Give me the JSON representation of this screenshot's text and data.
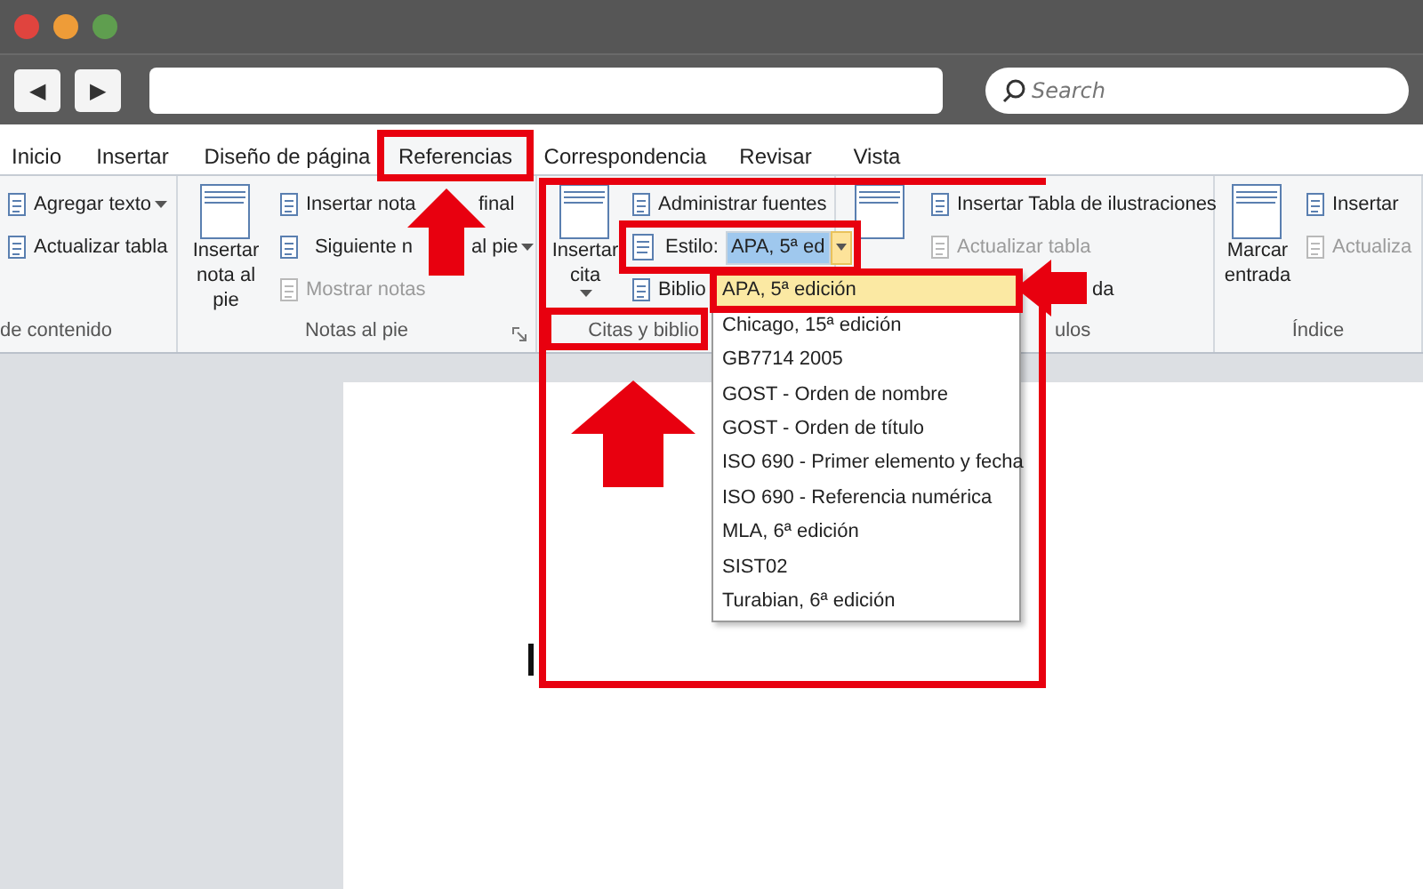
{
  "window": {
    "controls": [
      {
        "color": "#e0443e"
      },
      {
        "color": "#ee9c38"
      },
      {
        "color": "#5f9e4f"
      }
    ]
  },
  "browser": {
    "back": "◀",
    "forward": "▶",
    "search": {
      "placeholder": "Search"
    }
  },
  "tabs": [
    {
      "label": "Inicio",
      "selected": false
    },
    {
      "label": "Insertar",
      "selected": false
    },
    {
      "label": "Diseño de página",
      "selected": false
    },
    {
      "label": "Referencias",
      "selected": true
    },
    {
      "label": "Correspondencia",
      "selected": false
    },
    {
      "label": "Revisar",
      "selected": false
    },
    {
      "label": "Vista",
      "selected": false
    }
  ],
  "ribbon": {
    "groups": [
      {
        "label": "de contenido",
        "launcher": false,
        "items": [
          {
            "kind": "button",
            "parts": [
              "Agregar texto"
            ],
            "caret": true,
            "disabled": false
          },
          {
            "kind": "button",
            "parts": [
              "Actualizar tabla"
            ],
            "caret": false,
            "disabled": false
          }
        ]
      },
      {
        "label": "Notas al pie",
        "launcher": true,
        "big": {
          "label": "Insertar nota al pie",
          "caret": false
        },
        "items": [
          {
            "kind": "button",
            "parts": [
              "Insertar nota",
              "final"
            ],
            "caret": false,
            "disabled": false
          },
          {
            "kind": "button",
            "parts": [
              "Siguiente n",
              "al pie"
            ],
            "caret": true,
            "disabled": false
          },
          {
            "kind": "button",
            "parts": [
              "Mostrar notas"
            ],
            "caret": false,
            "disabled": true
          }
        ]
      },
      {
        "label": "Citas y biblio",
        "launcher": false,
        "big": {
          "label": "Insertar cita",
          "caret": true
        },
        "items": [
          {
            "kind": "button",
            "parts": [
              "Administrar fuentes"
            ],
            "caret": false,
            "disabled": false
          },
          {
            "kind": "style",
            "label": "Estilo:",
            "value": "APA, 5ª ed"
          },
          {
            "kind": "button",
            "parts": [
              "Biblio"
            ],
            "caret": false,
            "disabled": false
          }
        ]
      },
      {
        "label": "ulos",
        "launcher": false,
        "big": {
          "caret": false
        },
        "items": [
          {
            "kind": "button",
            "parts": [
              "Insertar Tabla de ilustraciones"
            ],
            "caret": false,
            "disabled": false
          },
          {
            "kind": "button",
            "parts": [
              "Actualizar tabla"
            ],
            "caret": false,
            "disabled": true
          },
          {
            "kind": "text",
            "label": "da"
          }
        ]
      },
      {
        "label": "Índice",
        "launcher": false,
        "big": {
          "label": "Marcar entrada",
          "caret": false
        },
        "items": [
          {
            "kind": "button",
            "parts": [
              "Insertar"
            ],
            "caret": false,
            "disabled": false
          },
          {
            "kind": "button",
            "parts": [
              "Actualiza"
            ],
            "caret": false,
            "disabled": true
          }
        ]
      }
    ]
  },
  "style_menu": {
    "options": [
      {
        "label": "APA, 5ª edición",
        "selected": true
      },
      {
        "label": "Chicago, 15ª edición",
        "selected": false
      },
      {
        "label": "GB7714 2005",
        "selected": false
      },
      {
        "label": "GOST - Orden de nombre",
        "selected": false
      },
      {
        "label": "GOST - Orden de título",
        "selected": false
      },
      {
        "label": "ISO 690 - Primer elemento y fecha",
        "selected": false
      },
      {
        "label": "ISO 690 - Referencia numérica",
        "selected": false
      },
      {
        "label": "MLA, 6ª edición",
        "selected": false
      },
      {
        "label": "SIST02",
        "selected": false
      },
      {
        "label": "Turabian, 6ª edición",
        "selected": false
      }
    ]
  }
}
